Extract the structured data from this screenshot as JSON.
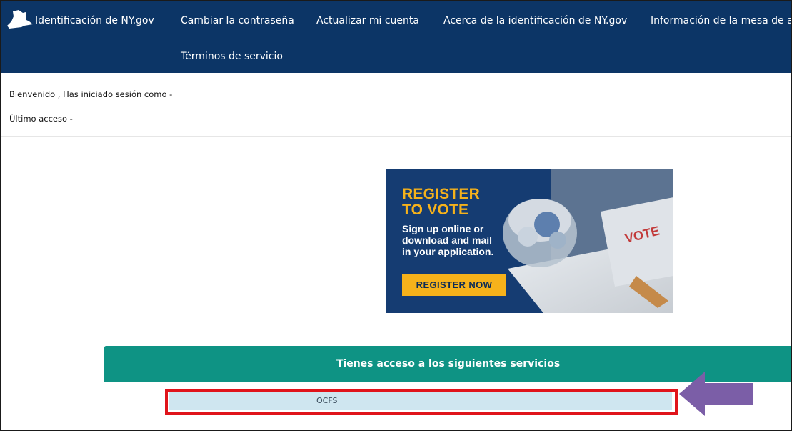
{
  "nav": {
    "items": [
      {
        "label": "Identificación de NY.gov"
      },
      {
        "label": "Cambiar la contraseña"
      },
      {
        "label": "Actualizar mi cuenta"
      },
      {
        "label": "Acerca de la identificación de NY.gov"
      },
      {
        "label": "Información de la mesa de a"
      },
      {
        "label": "Términos de servicio"
      }
    ]
  },
  "welcome": {
    "line1": "Bienvenido , Has iniciado sesión como -",
    "line2": "Último acceso -"
  },
  "banner": {
    "title_line1": "REGISTER",
    "title_line2": "TO VOTE",
    "body_lines": [
      "Sign up online or",
      "download and mail",
      "in your application."
    ],
    "button": "REGISTER NOW",
    "photo_text": "VOTE"
  },
  "services": {
    "title": "Tienes acceso a los siguientes servicios",
    "items": [
      {
        "label": "OCFS"
      }
    ]
  },
  "colors": {
    "nav_bg": "#0c3566",
    "services_header": "#0e9384",
    "highlight": "#e0141b",
    "arrow": "#7b5ea7",
    "banner_accent": "#f6b21b"
  },
  "icons": {
    "logo": "ny-state-icon",
    "pointer": "arrow-left-icon"
  }
}
